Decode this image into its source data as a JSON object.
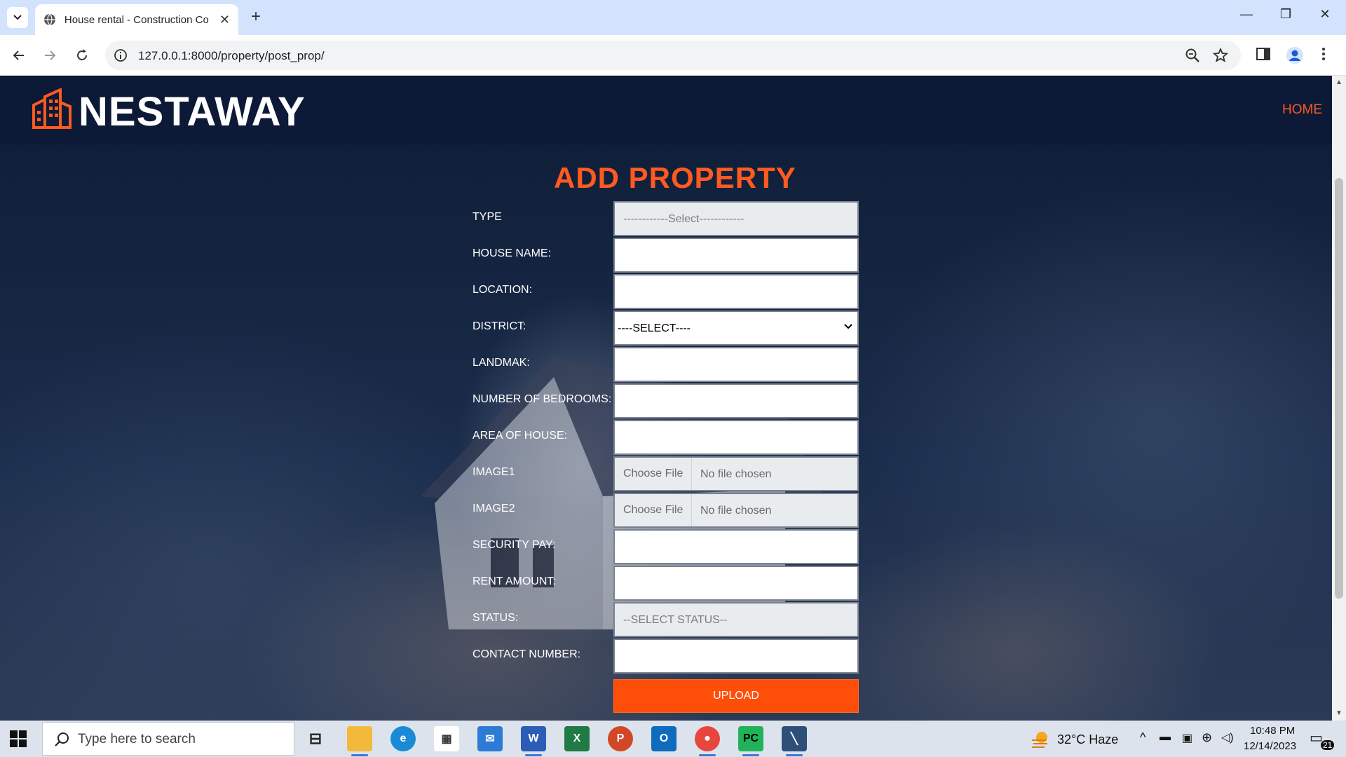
{
  "browser": {
    "tab_title": "House rental - Construction Co",
    "url": "127.0.0.1:8000/property/post_prop/"
  },
  "site": {
    "brand": "NESTAWAY",
    "nav_home": "HOME"
  },
  "form": {
    "title": "ADD PROPERTY",
    "fields": {
      "type": {
        "label": "TYPE",
        "placeholder": "------------Select------------"
      },
      "house_name": {
        "label": "HOUSE NAME:"
      },
      "location": {
        "label": "LOCATION:"
      },
      "district": {
        "label": "DISTRICT:",
        "value": "----SELECT----"
      },
      "landmark": {
        "label": "LANDMAK:"
      },
      "bedrooms": {
        "label": "NUMBER OF BEDROOMS:"
      },
      "area": {
        "label": "AREA OF HOUSE:"
      },
      "image1": {
        "label": "IMAGE1",
        "button": "Choose File",
        "file": "No file chosen"
      },
      "image2": {
        "label": "IMAGE2",
        "button": "Choose File",
        "file": "No file chosen"
      },
      "security": {
        "label": "SECURITY PAY:"
      },
      "rent": {
        "label": "RENT AMOUNT:"
      },
      "status": {
        "label": "STATUS:",
        "placeholder": "--SELECT STATUS--"
      },
      "contact": {
        "label": "CONTACT NUMBER:"
      }
    },
    "submit": "UPLOAD"
  },
  "taskbar": {
    "search_placeholder": "Type here to search",
    "weather": "32°C  Haze",
    "time": "10:48 PM",
    "date": "12/14/2023",
    "notifications": "21"
  }
}
